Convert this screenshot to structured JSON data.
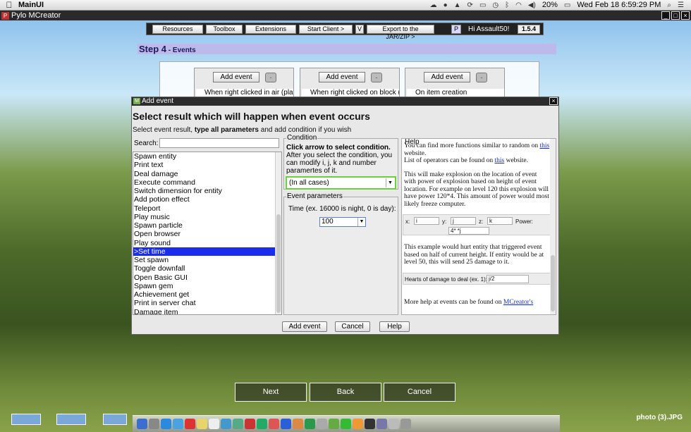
{
  "menubar": {
    "apple": "",
    "app_name": "MainUI",
    "battery": "20%",
    "clock": "Wed Feb 18  6:59:29 PM"
  },
  "titlebar": {
    "title": "Pylo MCreator",
    "logo": "P"
  },
  "toolbar": {
    "resources": "Resources",
    "toolbox": "Toolbox",
    "extensions": "Extensions",
    "start_client": "Start Client >",
    "v": "V",
    "export": "Export to the JAR/ZIP >",
    "p": "P",
    "greeting": "Hi Assault50!",
    "version": "1.5.4"
  },
  "step": {
    "title": "Step 4",
    "subtitle": " - Events"
  },
  "slots": [
    {
      "add": "Add event",
      "minus": "-",
      "text": "When right clicked in air (player"
    },
    {
      "add": "Add event",
      "minus": "-",
      "text": "When right clicked on block (ha"
    },
    {
      "add": "Add event",
      "minus": "-",
      "text": "On item creation"
    }
  ],
  "dialog": {
    "title": "Add event",
    "close": "×",
    "heading": "Select result which will happen when event occurs",
    "sub_pre": "Select event result, ",
    "sub_bold": "type all parameters",
    "sub_post": " and add condition if you wish",
    "search_label": "Search:",
    "search_value": "",
    "items": [
      "Spawn entity",
      "Print text",
      "Deal damage",
      "Execute command",
      "Switch dimension for entity",
      "Add potion effect",
      "Teleport",
      "Play music",
      "Spawn particle",
      "Open browser",
      "Play sound",
      ">Set time",
      "Set spawn",
      "Toggle downfall",
      "Open Basic GUI",
      "Spawn gem",
      "Achievement get",
      "Print in server chat",
      "Damage item"
    ],
    "condition": {
      "legend": "Condition",
      "bold": "Click arrow to select condition.",
      "text": "After you select the condition, you can modify i, j, k and number paramertes of it.",
      "selected": "(In all cases)"
    },
    "params": {
      "legend": "Event parameters",
      "label": "Time (ex. 16000 is night, 0 is day):",
      "value": "100"
    },
    "help": {
      "legend": "Help",
      "p1_pre": "You can find more functions similar to random on ",
      "p1_link": "this",
      "p1_post": " website.",
      "p1b_pre": "List of operators can be found on ",
      "p1b_link": "this",
      "p1b_post": " website.",
      "p2": "This will make explosion on the location of event with power of explosion based on height of event location. For example on level 120 this explosion will have power 120*4. This amount of power would most likely freeze computer.",
      "ex_x": "x:",
      "ex_x_val": "i",
      "ex_y": "y:",
      "ex_y_val": "j",
      "ex_z": "z:",
      "ex_z_val": "k",
      "ex_power": "Power:",
      "ex_power_val": "4* *j",
      "p3": "This example would hurt entity that triggered event based on half of current height. If entity would be at level 50, this will send 25 damage to it.",
      "ex2_label": "Hearts of damage to deal (ex. 1):",
      "ex2_val": "j/2",
      "p4_pre": "More help at events can be found on ",
      "p4_link": "MCreator's"
    },
    "buttons": {
      "add": "Add event",
      "cancel": "Cancel",
      "help": "Help"
    }
  },
  "bottom": {
    "next": "Next",
    "back": "Back",
    "cancel": "Cancel"
  },
  "photo_label": "photo (3).JPG"
}
